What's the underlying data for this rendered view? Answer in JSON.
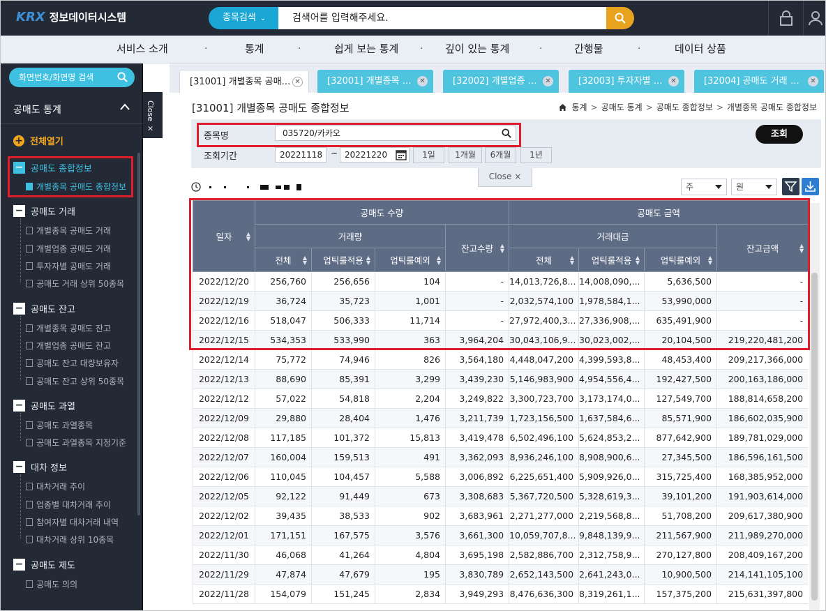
{
  "app": {
    "logo_text": "KRX",
    "system_name": "정보데이터시스템"
  },
  "search": {
    "type_label": "종목검색",
    "placeholder": "검색어를 입력해주세요."
  },
  "nav": {
    "items": [
      "서비스 소개",
      "통계",
      "쉽게 보는 통계",
      "깊이 있는 통계",
      "간행물",
      "데이터 상품"
    ],
    "separator": "·"
  },
  "sidebar": {
    "search_label": "화면번호/화면명 검색",
    "title": "공매도 통계",
    "expand_all": "전체열기",
    "close_label": "Close ×",
    "groups": [
      {
        "label": "공매도 종합정보",
        "items": [
          "개별종목 공매도 종합정보"
        ]
      },
      {
        "label": "공매도 거래",
        "items": [
          "개별종목 공매도 거래",
          "개별업종 공매도 거래",
          "투자자별 공매도 거래",
          "공매도 거래 상위 50종목"
        ]
      },
      {
        "label": "공매도 잔고",
        "items": [
          "개별종목 공매도 잔고",
          "개별업종 공매도 잔고",
          "공매도 잔고 대량보유자",
          "공매도 잔고 상위 50종목"
        ]
      },
      {
        "label": "공매도 과열",
        "items": [
          "공매도 과열종목",
          "공매도 과열종목 지정기준"
        ]
      },
      {
        "label": "대차 정보",
        "items": [
          "대차거래 추이",
          "업종별 대차거래 추이",
          "참여자별 대차거래 내역",
          "대차거래 상위 10종목"
        ]
      },
      {
        "label": "공매도 제도",
        "items": [
          "공매도 의의"
        ]
      }
    ]
  },
  "tabs": [
    {
      "label": "[31001] 개별종목 공매…"
    },
    {
      "label": "[32001] 개별종목 …"
    },
    {
      "label": "[32002] 개별업종 …"
    },
    {
      "label": "[32003] 투자자별 …"
    },
    {
      "label": "[32004] 공매도 거래 …"
    }
  ],
  "page": {
    "title": "[31001] 개별종목 공매도 종합정보",
    "breadcrumb": [
      "통계",
      "공매도 통계",
      "공매도 종합정보",
      "개별종목 공매도 종합정보"
    ]
  },
  "filter": {
    "stock_label": "종목명",
    "stock_value": "035720/카카오",
    "period_label": "조회기간",
    "from": "20221118",
    "tilde": "~",
    "to": "20221220",
    "periods": [
      "1일",
      "1개월",
      "6개월",
      "1년"
    ],
    "query_button": "조회",
    "close_button": "Close ×"
  },
  "toolbar": {
    "unit": "주",
    "currency": "원"
  },
  "table": {
    "header_groups": {
      "volume_group": "공매도 수량",
      "amount_group": "공매도 금액",
      "trade_volume": "거래량",
      "trade_amount": "거래대금"
    },
    "columns": {
      "date": "일자",
      "total": "전체",
      "uptick_applied": "업틱룰적용",
      "uptick_excluded": "업틱룰예외",
      "balance_qty": "잔고수량",
      "amt_total": "전체",
      "amt_uptick_applied": "업틱룰적용",
      "amt_uptick_excluded": "업틱룰예외",
      "balance_amt": "잔고금액"
    },
    "rows": [
      [
        "2022/12/20",
        "256,760",
        "256,656",
        "104",
        "-",
        "14,013,726,8...",
        "14,008,090,...",
        "5,636,500",
        "-"
      ],
      [
        "2022/12/19",
        "36,724",
        "35,723",
        "1,001",
        "-",
        "2,032,574,100",
        "1,978,584,1...",
        "53,990,000",
        "-"
      ],
      [
        "2022/12/16",
        "518,047",
        "506,333",
        "11,714",
        "-",
        "27,972,400,3...",
        "27,336,908,...",
        "635,491,900",
        "-"
      ],
      [
        "2022/12/15",
        "534,353",
        "533,990",
        "363",
        "3,964,204",
        "30,043,106,9...",
        "30,023,002,...",
        "20,104,500",
        "219,220,481,200"
      ],
      [
        "2022/12/14",
        "75,772",
        "74,946",
        "826",
        "3,564,180",
        "4,448,047,200",
        "4,399,593,8...",
        "48,453,400",
        "209,217,366,000"
      ],
      [
        "2022/12/13",
        "88,690",
        "85,391",
        "3,299",
        "3,439,230",
        "5,146,983,900",
        "4,954,556,4...",
        "192,427,500",
        "200,163,186,000"
      ],
      [
        "2022/12/12",
        "57,022",
        "54,818",
        "2,204",
        "3,249,822",
        "3,300,723,700",
        "3,173,174,0...",
        "127,549,700",
        "188,814,658,200"
      ],
      [
        "2022/12/09",
        "29,880",
        "28,404",
        "1,476",
        "3,211,739",
        "1,723,156,500",
        "1,637,584,6...",
        "85,571,900",
        "186,602,035,900"
      ],
      [
        "2022/12/08",
        "117,185",
        "101,372",
        "15,813",
        "3,419,478",
        "6,502,496,100",
        "5,624,853,2...",
        "877,642,900",
        "189,781,029,000"
      ],
      [
        "2022/12/07",
        "160,004",
        "159,513",
        "491",
        "3,362,093",
        "8,936,246,100",
        "8,908,900,6...",
        "27,345,500",
        "186,596,161,500"
      ],
      [
        "2022/12/06",
        "110,045",
        "104,457",
        "5,588",
        "3,006,892",
        "6,225,651,400",
        "5,909,926,0...",
        "315,725,400",
        "168,385,952,000"
      ],
      [
        "2022/12/05",
        "92,122",
        "91,449",
        "673",
        "3,308,683",
        "5,367,720,500",
        "5,328,619,3...",
        "39,101,200",
        "191,903,614,000"
      ],
      [
        "2022/12/02",
        "39,435",
        "38,533",
        "902",
        "3,683,961",
        "2,271,277,000",
        "2,219,568,8...",
        "51,708,200",
        "209,617,380,900"
      ],
      [
        "2022/12/01",
        "171,151",
        "167,575",
        "3,576",
        "3,661,300",
        "10,059,707,8...",
        "9,848,139,9...",
        "211,567,900",
        "211,989,270,000"
      ],
      [
        "2022/11/30",
        "46,068",
        "41,264",
        "4,804",
        "3,695,198",
        "2,582,886,700",
        "2,312,758,9...",
        "270,127,800",
        "208,409,167,200"
      ],
      [
        "2022/11/29",
        "47,874",
        "47,679",
        "195",
        "3,830,789",
        "2,652,143,500",
        "2,641,243,0...",
        "10,900,500",
        "214,141,105,100"
      ],
      [
        "2022/11/28",
        "154,079",
        "151,245",
        "2,834",
        "3,949,293",
        "8,476,636,300",
        "8,319,261,1...",
        "157,375,200",
        "215,631,397,800"
      ]
    ]
  },
  "colors": {
    "topbar": "#232a36",
    "accent": "#1aa7d6",
    "search_btn": "#e8a31e",
    "highlight_box": "#e01e2b",
    "table_header": "#5e6b85"
  }
}
